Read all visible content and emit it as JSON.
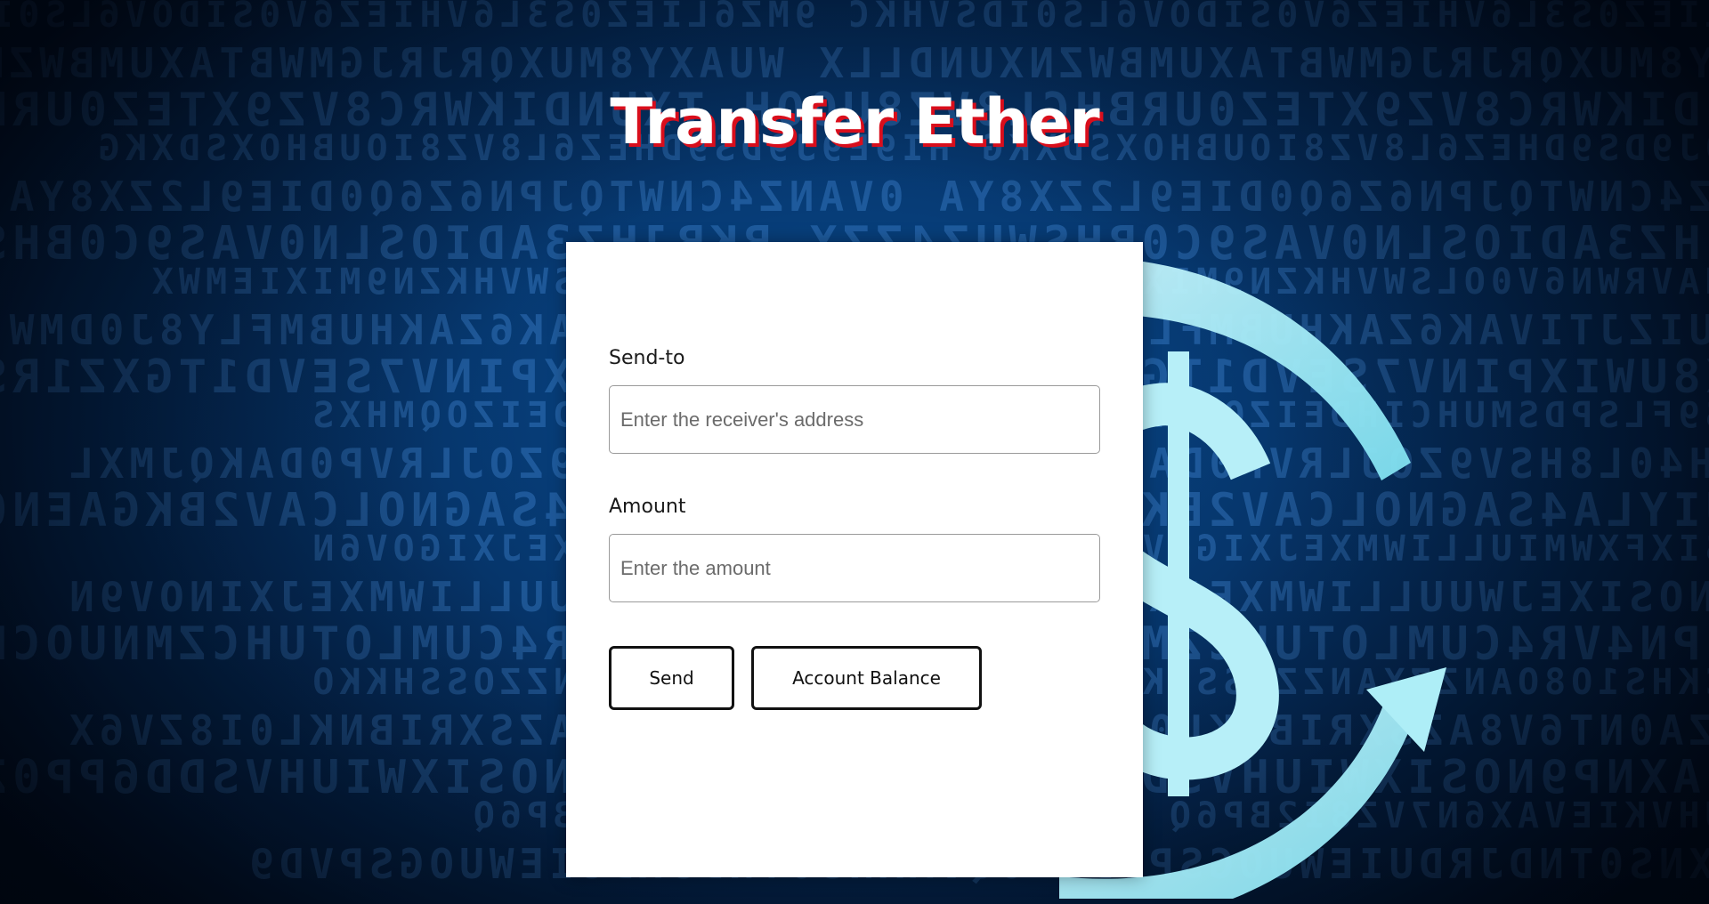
{
  "page": {
    "title": "Transfer Ether"
  },
  "form": {
    "send_to": {
      "label": "Send-to",
      "placeholder": "Enter the receiver's address",
      "value": ""
    },
    "amount": {
      "label": "Amount",
      "placeholder": "Enter the amount",
      "value": ""
    },
    "buttons": {
      "send_label": "Send",
      "balance_label": "Account Balance"
    }
  },
  "background": {
    "icon": "dollar-exchange-icon",
    "glyph_rows": [
      "9MZ6LIEZ0S3L6VHIEZ6V0SIDOV6LS0IDSVHKC",
      "WUAXY8MUXQRJRJGMWBTAXUMBWZNXUNDLLX",
      "TXUNDIKWRC8VZ9XTEZ0URBHCL8VZ8UOQH",
      "HI9E9J9DS9DHEZ6L8VZ8IOUBHOXSDXKG",
      "0VANZ4CNWTQJPN6Z6Q0DIE9L2ZX8YA",
      "BKBJHZ3ADIOSLN0VAS9C0BHSWUZ4ZZX",
      "0DIZNAVRWN6V0OLSWVHKZN9MIXIEMWX",
      "G8BKUIZJTIVAK6ZAKHUBMFLY8J0DMW",
      "WEIX8UWIXPINV7SEVD1TGXZ1RSDVA",
      "HI8JS9FLSPDSMUHCIHDEIZOQMHXS",
      "CCSSH40L8HSV9ZOJLRVP0DAKQJMXL",
      "OKKUIYLA4SAGNOLCAV2BKGAEN0AVR",
      "N9NOSIXFXWMIULLIWMXEJXIGOV6N",
      "XRNPNOSIXEJWUULLIWMXEJXINOV9N",
      "CZ69PN4VR4CUMLOTUHCZMNUOCDGZX",
      "ANZZCKHS1O8OANZZXANZZOSSHKKO",
      "BKV6ZA0NT6V8AZSXRIBNKL0I8ZV6X",
      "ZN09AXNP9NOSIXWIUHVSDD6PP0ZN",
      "DHILUHVKIEVAX6N7VZ8I2BP6Q",
      "0QVAXNS0TNDJRDUIEWUOGSPVD9"
    ]
  }
}
